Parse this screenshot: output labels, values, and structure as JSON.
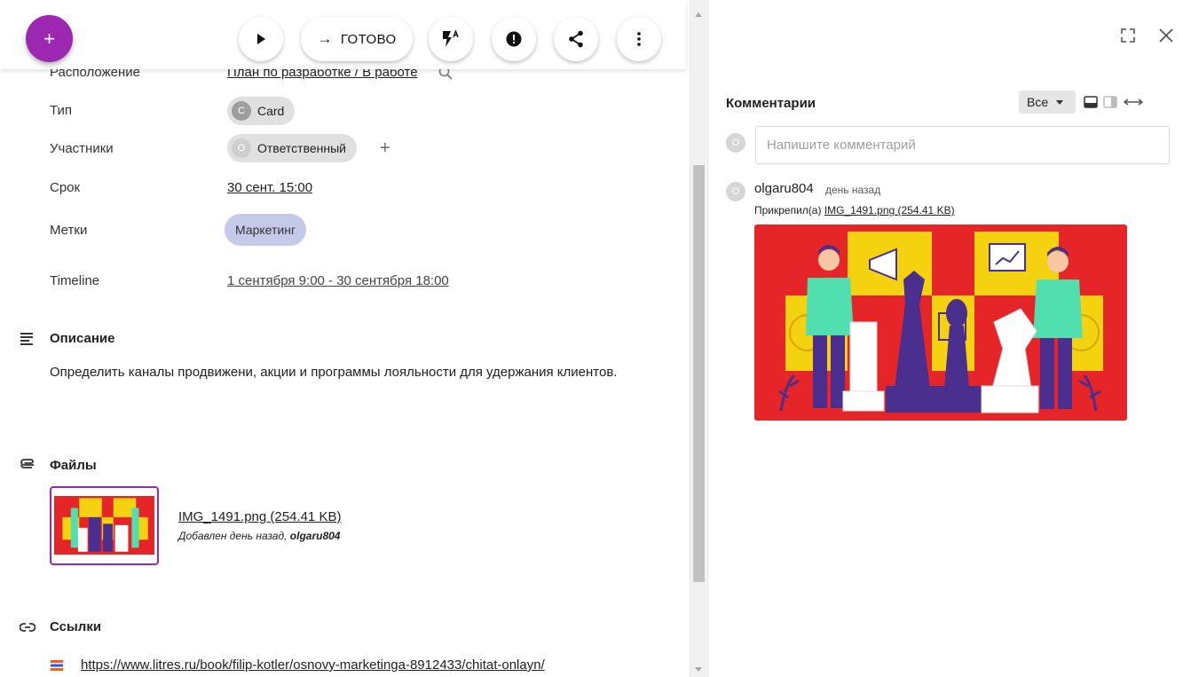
{
  "toolbar": {
    "fab_label": "+",
    "done_label": "ГОТОВО",
    "done_arrow": "→"
  },
  "properties": {
    "location_label": "Расположение",
    "location_value": "План по разработке / В работе",
    "type_label": "Тип",
    "type_avatar": "C",
    "type_value": "Card",
    "members_label": "Участники",
    "members_avatar": "O",
    "members_value": "Ответственный",
    "members_add": "+",
    "due_label": "Срок",
    "due_value": "30 сент. 15:00",
    "tags_label": "Метки",
    "tag_value": "Маркетинг",
    "timeline_label": "Timeline",
    "timeline_value": "1 сентября 9:00 - 30 сентября 18:00"
  },
  "description": {
    "title": "Описание",
    "text": "Определить каналы продвижени, акции и программы лояльности для удержания клиентов."
  },
  "files": {
    "title": "Файлы",
    "name": "IMG_1491.png (254.41 KB)",
    "meta_prefix": "Добавлен день назад, ",
    "meta_author": "olgaru804"
  },
  "links": {
    "title": "Ссылки",
    "url": "https://www.litres.ru/book/filip-kotler/osnovy-marketinga-8912433/chitat-onlayn/"
  },
  "comments": {
    "title": "Комментарии",
    "filter_value": "Все",
    "input_placeholder": "Напишите комментарий",
    "user_avatar": "O",
    "author": "olgaru804",
    "when": "день назад",
    "attached_prefix": "Прикрепил(а) ",
    "attached_file": "IMG_1491.png (254.41 KB)"
  },
  "colors": {
    "accent": "#9c27b0",
    "tag_bg": "#c5cae9",
    "chip_bg": "#e0e0e0",
    "image_red": "#e52528",
    "image_yellow": "#f5d20f",
    "image_purple": "#4b2f8f",
    "image_mint": "#52dfb0"
  }
}
